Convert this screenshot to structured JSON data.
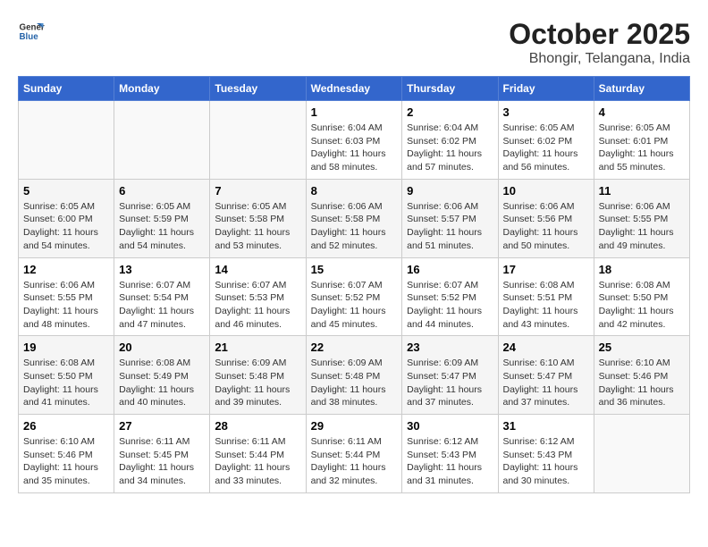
{
  "header": {
    "logo_line1": "General",
    "logo_line2": "Blue",
    "title": "October 2025",
    "subtitle": "Bhongir, Telangana, India"
  },
  "days_of_week": [
    "Sunday",
    "Monday",
    "Tuesday",
    "Wednesday",
    "Thursday",
    "Friday",
    "Saturday"
  ],
  "weeks": [
    [
      {
        "day": "",
        "info": ""
      },
      {
        "day": "",
        "info": ""
      },
      {
        "day": "",
        "info": ""
      },
      {
        "day": "1",
        "info": "Sunrise: 6:04 AM\nSunset: 6:03 PM\nDaylight: 11 hours\nand 58 minutes."
      },
      {
        "day": "2",
        "info": "Sunrise: 6:04 AM\nSunset: 6:02 PM\nDaylight: 11 hours\nand 57 minutes."
      },
      {
        "day": "3",
        "info": "Sunrise: 6:05 AM\nSunset: 6:02 PM\nDaylight: 11 hours\nand 56 minutes."
      },
      {
        "day": "4",
        "info": "Sunrise: 6:05 AM\nSunset: 6:01 PM\nDaylight: 11 hours\nand 55 minutes."
      }
    ],
    [
      {
        "day": "5",
        "info": "Sunrise: 6:05 AM\nSunset: 6:00 PM\nDaylight: 11 hours\nand 54 minutes."
      },
      {
        "day": "6",
        "info": "Sunrise: 6:05 AM\nSunset: 5:59 PM\nDaylight: 11 hours\nand 54 minutes."
      },
      {
        "day": "7",
        "info": "Sunrise: 6:05 AM\nSunset: 5:58 PM\nDaylight: 11 hours\nand 53 minutes."
      },
      {
        "day": "8",
        "info": "Sunrise: 6:06 AM\nSunset: 5:58 PM\nDaylight: 11 hours\nand 52 minutes."
      },
      {
        "day": "9",
        "info": "Sunrise: 6:06 AM\nSunset: 5:57 PM\nDaylight: 11 hours\nand 51 minutes."
      },
      {
        "day": "10",
        "info": "Sunrise: 6:06 AM\nSunset: 5:56 PM\nDaylight: 11 hours\nand 50 minutes."
      },
      {
        "day": "11",
        "info": "Sunrise: 6:06 AM\nSunset: 5:55 PM\nDaylight: 11 hours\nand 49 minutes."
      }
    ],
    [
      {
        "day": "12",
        "info": "Sunrise: 6:06 AM\nSunset: 5:55 PM\nDaylight: 11 hours\nand 48 minutes."
      },
      {
        "day": "13",
        "info": "Sunrise: 6:07 AM\nSunset: 5:54 PM\nDaylight: 11 hours\nand 47 minutes."
      },
      {
        "day": "14",
        "info": "Sunrise: 6:07 AM\nSunset: 5:53 PM\nDaylight: 11 hours\nand 46 minutes."
      },
      {
        "day": "15",
        "info": "Sunrise: 6:07 AM\nSunset: 5:52 PM\nDaylight: 11 hours\nand 45 minutes."
      },
      {
        "day": "16",
        "info": "Sunrise: 6:07 AM\nSunset: 5:52 PM\nDaylight: 11 hours\nand 44 minutes."
      },
      {
        "day": "17",
        "info": "Sunrise: 6:08 AM\nSunset: 5:51 PM\nDaylight: 11 hours\nand 43 minutes."
      },
      {
        "day": "18",
        "info": "Sunrise: 6:08 AM\nSunset: 5:50 PM\nDaylight: 11 hours\nand 42 minutes."
      }
    ],
    [
      {
        "day": "19",
        "info": "Sunrise: 6:08 AM\nSunset: 5:50 PM\nDaylight: 11 hours\nand 41 minutes."
      },
      {
        "day": "20",
        "info": "Sunrise: 6:08 AM\nSunset: 5:49 PM\nDaylight: 11 hours\nand 40 minutes."
      },
      {
        "day": "21",
        "info": "Sunrise: 6:09 AM\nSunset: 5:48 PM\nDaylight: 11 hours\nand 39 minutes."
      },
      {
        "day": "22",
        "info": "Sunrise: 6:09 AM\nSunset: 5:48 PM\nDaylight: 11 hours\nand 38 minutes."
      },
      {
        "day": "23",
        "info": "Sunrise: 6:09 AM\nSunset: 5:47 PM\nDaylight: 11 hours\nand 37 minutes."
      },
      {
        "day": "24",
        "info": "Sunrise: 6:10 AM\nSunset: 5:47 PM\nDaylight: 11 hours\nand 37 minutes."
      },
      {
        "day": "25",
        "info": "Sunrise: 6:10 AM\nSunset: 5:46 PM\nDaylight: 11 hours\nand 36 minutes."
      }
    ],
    [
      {
        "day": "26",
        "info": "Sunrise: 6:10 AM\nSunset: 5:46 PM\nDaylight: 11 hours\nand 35 minutes."
      },
      {
        "day": "27",
        "info": "Sunrise: 6:11 AM\nSunset: 5:45 PM\nDaylight: 11 hours\nand 34 minutes."
      },
      {
        "day": "28",
        "info": "Sunrise: 6:11 AM\nSunset: 5:44 PM\nDaylight: 11 hours\nand 33 minutes."
      },
      {
        "day": "29",
        "info": "Sunrise: 6:11 AM\nSunset: 5:44 PM\nDaylight: 11 hours\nand 32 minutes."
      },
      {
        "day": "30",
        "info": "Sunrise: 6:12 AM\nSunset: 5:43 PM\nDaylight: 11 hours\nand 31 minutes."
      },
      {
        "day": "31",
        "info": "Sunrise: 6:12 AM\nSunset: 5:43 PM\nDaylight: 11 hours\nand 30 minutes."
      },
      {
        "day": "",
        "info": ""
      }
    ]
  ]
}
